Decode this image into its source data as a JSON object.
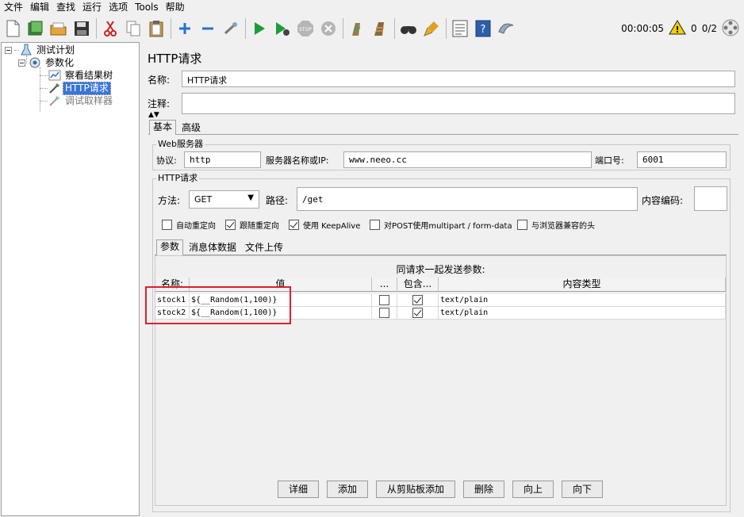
{
  "menu": [
    "文件",
    "编辑",
    "查找",
    "运行",
    "选项",
    "Tools",
    "帮助"
  ],
  "toolbar": {
    "icons": [
      "new-icon",
      "templates-icon",
      "open-icon",
      "save-icon",
      "cut-icon",
      "copy-icon",
      "paste-icon",
      "expand-icon",
      "collapse-icon",
      "toggle-icon",
      "start-icon",
      "start-no-pause-icon",
      "stop-icon",
      "shutdown-icon",
      "clear-icon",
      "clear-all-icon",
      "search-icon",
      "reset-search-icon",
      "function-helper-icon",
      "help-icon",
      "remote-icon"
    ],
    "timer": "00:00:05",
    "warning_count": "0",
    "threads": "0/2",
    "accent_green": "#1a9e3a",
    "accent_blue": "#2a6fd6"
  },
  "tree": {
    "test_plan": "测试计划",
    "thread_group": "参数化",
    "result_tree": "察看结果树",
    "http_request": "HTTP请求",
    "debug_sampler": "调试取样器"
  },
  "panel": {
    "title": "HTTP请求",
    "name_label": "名称:",
    "name_value": "HTTP请求",
    "comment_label": "注释:",
    "comment_value": "",
    "tabs": [
      "基本",
      "高级"
    ],
    "web_server": {
      "title": "Web服务器",
      "protocol_label": "协议:",
      "protocol_value": "http",
      "server_label": "服务器名称或IP:",
      "server_value": "www.neeo.cc",
      "port_label": "端口号:",
      "port_value": "6001"
    },
    "http": {
      "title": "HTTP请求",
      "method_label": "方法:",
      "method_value": "GET",
      "path_label": "路径:",
      "path_value": "/get",
      "encoding_label": "内容编码:",
      "encoding_value": ""
    },
    "options": [
      {
        "label": "自动重定向",
        "checked": false
      },
      {
        "label": "跟随重定向",
        "checked": true
      },
      {
        "label": "使用 KeepAlive",
        "checked": true
      },
      {
        "label": "对POST使用multipart / form-data",
        "checked": false
      },
      {
        "label": "与浏览器兼容的头",
        "checked": false
      }
    ],
    "sub_tabs": [
      "参数",
      "消息体数据",
      "文件上传"
    ],
    "params_caption": "同请求一起发送参数:",
    "columns": [
      "名称:",
      "值",
      "...",
      "包含...",
      "内容类型"
    ],
    "rows": [
      {
        "name": "stock1",
        "value": "${__Random(1,100)}",
        "encode": false,
        "include": true,
        "content_type": "text/plain"
      },
      {
        "name": "stock2",
        "value": "${__Random(1,100)}",
        "encode": false,
        "include": true,
        "content_type": "text/plain"
      }
    ],
    "buttons": [
      "详细",
      "添加",
      "从剪贴板添加",
      "删除",
      "向上",
      "向下"
    ]
  }
}
